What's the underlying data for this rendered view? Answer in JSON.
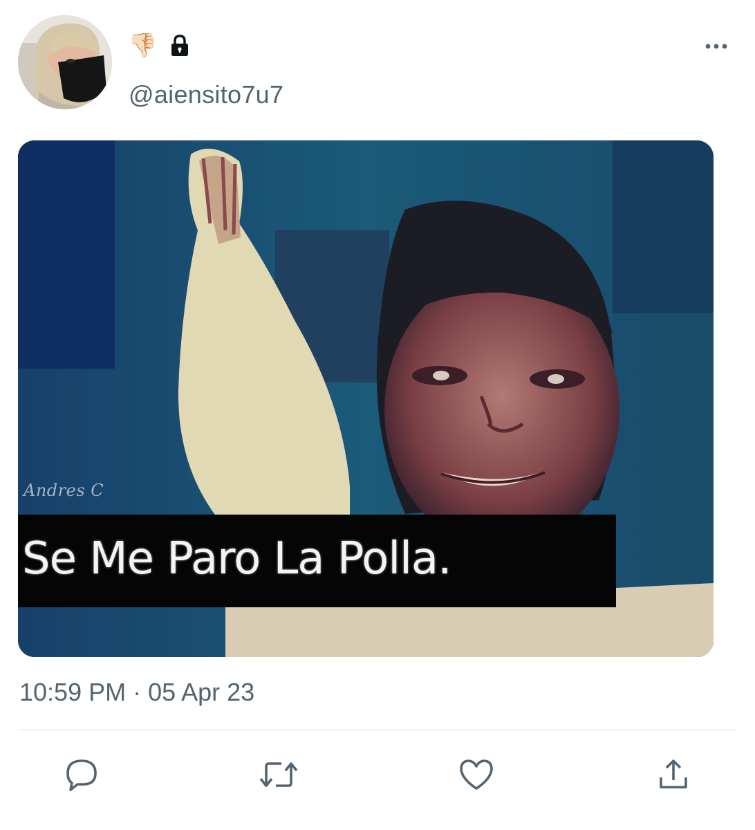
{
  "tweet": {
    "display_name_emoji": "👎🏻",
    "handle": "@aiensito7u7",
    "timestamp": "10:59 PM · 05 Apr 23"
  },
  "media": {
    "watermark": "Andres C",
    "caption": "Se Me Paro La Polla."
  },
  "icons": {
    "protected": "lock-icon",
    "more": "more-icon",
    "reply": "reply-icon",
    "retweet": "retweet-icon",
    "like": "like-icon",
    "share": "share-icon"
  },
  "colors": {
    "secondary_text": "#536471",
    "icon": "#536471",
    "divider": "#eff3f4"
  }
}
